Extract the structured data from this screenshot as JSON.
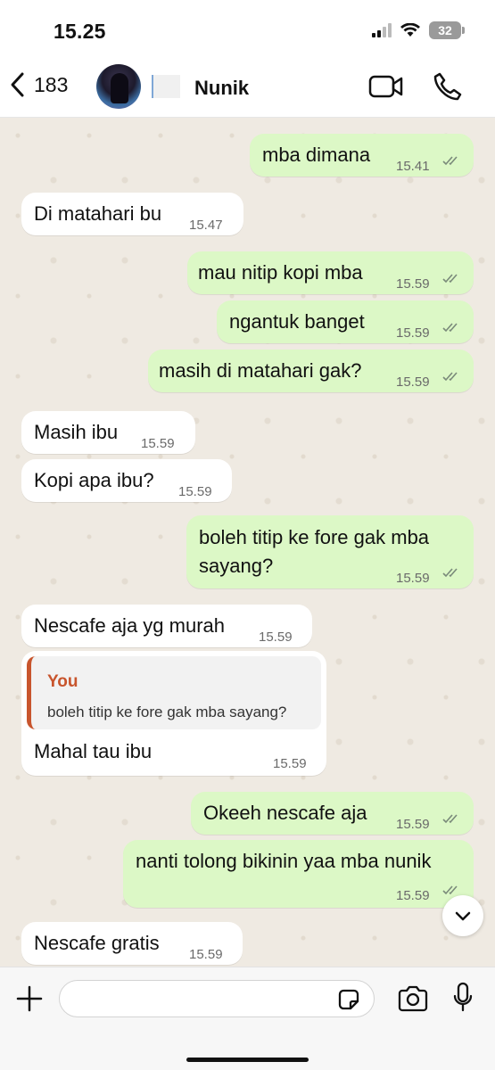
{
  "status_bar": {
    "time": "15.25",
    "battery": "32"
  },
  "header": {
    "back_count": "183",
    "contact_name": "Nunik"
  },
  "messages": [
    {
      "dir": "out",
      "text": "mba dimana",
      "time": "15.41",
      "read": true
    },
    {
      "dir": "in",
      "text": "Di matahari bu",
      "time": "15.47"
    },
    {
      "dir": "out",
      "text": "mau nitip kopi mba",
      "time": "15.59",
      "read": true
    },
    {
      "dir": "out",
      "text": "ngantuk banget",
      "time": "15.59",
      "read": true
    },
    {
      "dir": "out",
      "text": "masih di matahari gak?",
      "time": "15.59",
      "read": true
    },
    {
      "dir": "in",
      "text": "Masih ibu",
      "time": "15.59"
    },
    {
      "dir": "in",
      "text": "Kopi apa ibu?",
      "time": "15.59"
    },
    {
      "dir": "out",
      "text_line1": "boleh titip ke fore gak mba",
      "text_line2": "sayang?",
      "time": "15.59",
      "read": true
    },
    {
      "dir": "in",
      "text": "Nescafe aja yg murah",
      "time": "15.59"
    },
    {
      "dir": "in",
      "quote_author": "You",
      "quote_text": "boleh titip ke fore gak mba sayang?",
      "text": "Mahal tau ibu",
      "time": "15.59"
    },
    {
      "dir": "out",
      "text": "Okeeh nescafe aja",
      "time": "15.59",
      "read": true
    },
    {
      "dir": "out",
      "text": "nanti tolong bikinin yaa mba nunik",
      "time": "15.59",
      "read": true
    },
    {
      "dir": "in",
      "text": "Nescafe gratis",
      "time": "15.59"
    }
  ],
  "composer": {
    "placeholder": ""
  },
  "colors": {
    "outgoing_bubble": "#dcf8c6",
    "incoming_bubble": "#ffffff",
    "chat_background": "#efeae2",
    "read_check": "#7a8a7a",
    "quote_accent": "#c8552d"
  },
  "icons": [
    "back-chevron-icon",
    "video-camera-icon",
    "phone-icon",
    "read-check-icon",
    "chevron-down-icon",
    "plus-icon",
    "sticker-icon",
    "camera-icon",
    "microphone-icon"
  ]
}
